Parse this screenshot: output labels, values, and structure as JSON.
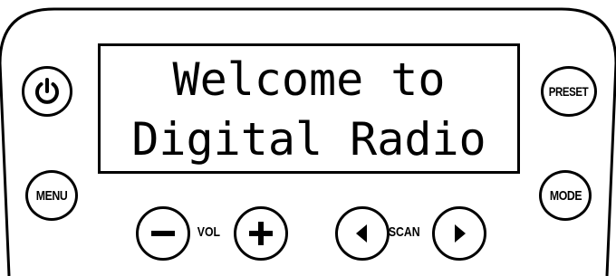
{
  "display": {
    "line1": "Welcome to",
    "line2": "Digital Radio"
  },
  "buttons": {
    "power": {
      "icon": "power-icon"
    },
    "preset": {
      "label": "PRESET"
    },
    "menu": {
      "label": "MENU"
    },
    "mode": {
      "label": "MODE"
    },
    "vol_down": {
      "icon": "minus-icon"
    },
    "vol_up": {
      "icon": "plus-icon"
    },
    "scan_back": {
      "icon": "triangle-left-icon"
    },
    "scan_forward": {
      "icon": "triangle-right-icon"
    }
  },
  "labels": {
    "vol": "VOL",
    "scan": "SCAN"
  }
}
